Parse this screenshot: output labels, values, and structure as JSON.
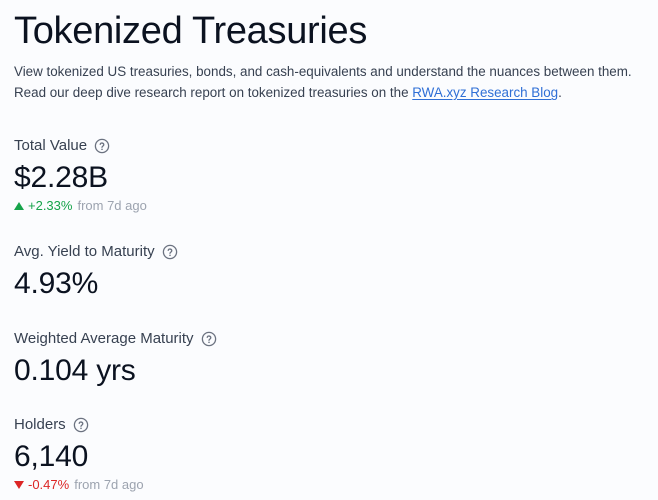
{
  "header": {
    "title": "Tokenized Treasuries",
    "description_text": "View tokenized US treasuries, bonds, and cash-equivalents and understand the nuances between them. Read our deep dive research report on tokenized treasuries on the ",
    "description_link": "RWA.xyz Research Blog",
    "description_end": "."
  },
  "metrics": {
    "total_value": {
      "label": "Total Value",
      "value": "$2.28B",
      "change": "+2.33%",
      "since": "from 7d ago"
    },
    "avg_yield": {
      "label": "Avg. Yield to Maturity",
      "value": "4.93%"
    },
    "wam": {
      "label": "Weighted Average Maturity",
      "value": "0.104 yrs"
    },
    "holders": {
      "label": "Holders",
      "value": "6,140",
      "change": "-0.47%",
      "since": "from 7d ago"
    }
  },
  "colors": {
    "positive": "#16a34a",
    "negative": "#dc2626",
    "link": "#2f6fd6"
  },
  "icons": {
    "help": "question-circle-icon",
    "up": "triangle-up-icon",
    "down": "triangle-down-icon"
  }
}
